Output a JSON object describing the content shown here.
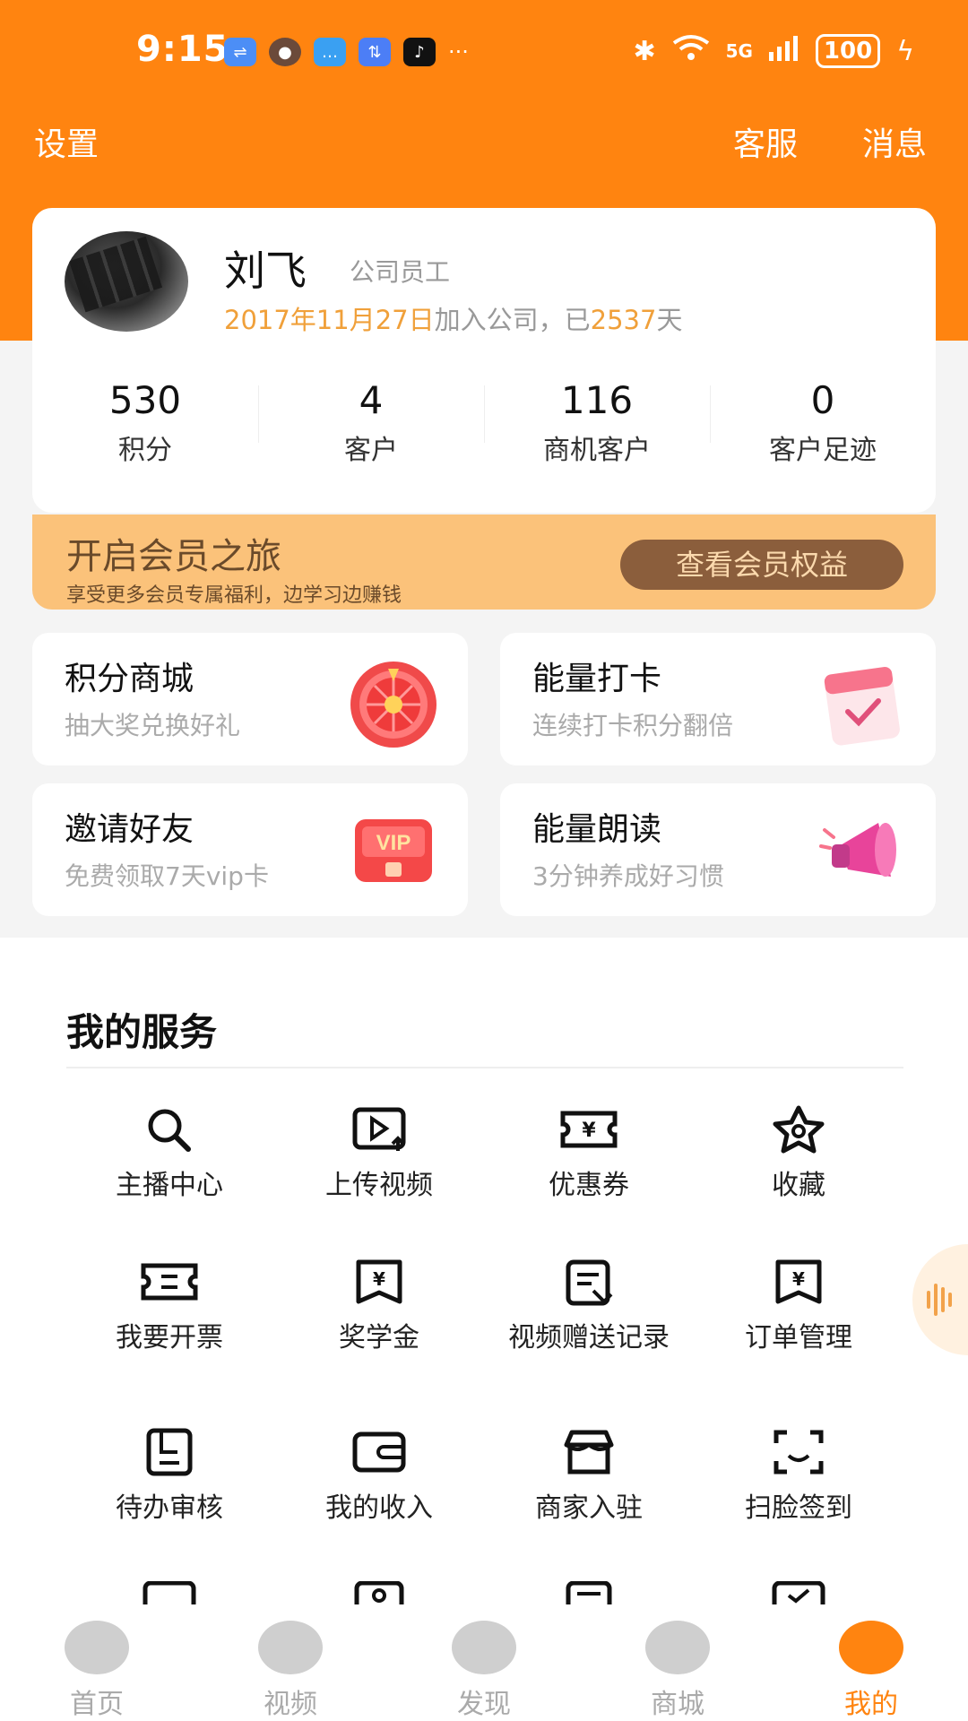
{
  "status_bar": {
    "time": "9:15",
    "network": "5G",
    "battery": "100"
  },
  "header": {
    "settings": "设置",
    "service": "客服",
    "messages": "消息"
  },
  "profile": {
    "name": "刘飞",
    "role": "公司员工",
    "join_date": "2017年11月27日",
    "join_text": "加入公司，",
    "already": "已",
    "days": "2537",
    "days_unit": "天",
    "stats": [
      {
        "value": "530",
        "label": "积分"
      },
      {
        "value": "4",
        "label": "客户"
      },
      {
        "value": "116",
        "label": "商机客户"
      },
      {
        "value": "0",
        "label": "客户足迹"
      }
    ]
  },
  "vip": {
    "title": "开启会员之旅",
    "subtitle": "享受更多会员专属福利，边学习边赚钱",
    "button": "查看会员权益"
  },
  "features": [
    {
      "title": "积分商城",
      "subtitle": "抽大奖兑换好礼",
      "icon": "prize-wheel-icon"
    },
    {
      "title": "能量打卡",
      "subtitle": "连续打卡积分翻倍",
      "icon": "calendar-check-icon"
    },
    {
      "title": "邀请好友",
      "subtitle": "免费领取7天vip卡",
      "icon": "vip-card-icon"
    },
    {
      "title": "能量朗读",
      "subtitle": "3分钟养成好习惯",
      "icon": "megaphone-icon"
    }
  ],
  "services": {
    "heading": "我的服务",
    "items": [
      {
        "label": "主播中心",
        "icon": "search-icon"
      },
      {
        "label": "上传视频",
        "icon": "upload-video-icon"
      },
      {
        "label": "优惠券",
        "icon": "coupon-icon"
      },
      {
        "label": "收藏",
        "icon": "star-icon"
      },
      {
        "label": "我要开票",
        "icon": "invoice-icon"
      },
      {
        "label": "奖学金",
        "icon": "scholarship-icon"
      },
      {
        "label": "视频赠送记录",
        "icon": "gift-record-icon"
      },
      {
        "label": "订单管理",
        "icon": "order-icon"
      },
      {
        "label": "待办审核",
        "icon": "review-icon"
      },
      {
        "label": "我的收入",
        "icon": "wallet-icon"
      },
      {
        "label": "商家入驻",
        "icon": "store-icon"
      },
      {
        "label": "扫脸签到",
        "icon": "face-scan-icon"
      }
    ]
  },
  "tabbar": {
    "items": [
      {
        "label": "首页",
        "icon": "home-icon"
      },
      {
        "label": "视频",
        "icon": "video-icon"
      },
      {
        "label": "发现",
        "icon": "discover-icon"
      },
      {
        "label": "商城",
        "icon": "mall-icon"
      },
      {
        "label": "我的",
        "icon": "profile-icon"
      }
    ]
  },
  "colors": {
    "brand": "#ff8410",
    "vip_bg": "#fbc27a",
    "vip_button": "#8b5e3c",
    "highlight": "#f0a03a"
  }
}
